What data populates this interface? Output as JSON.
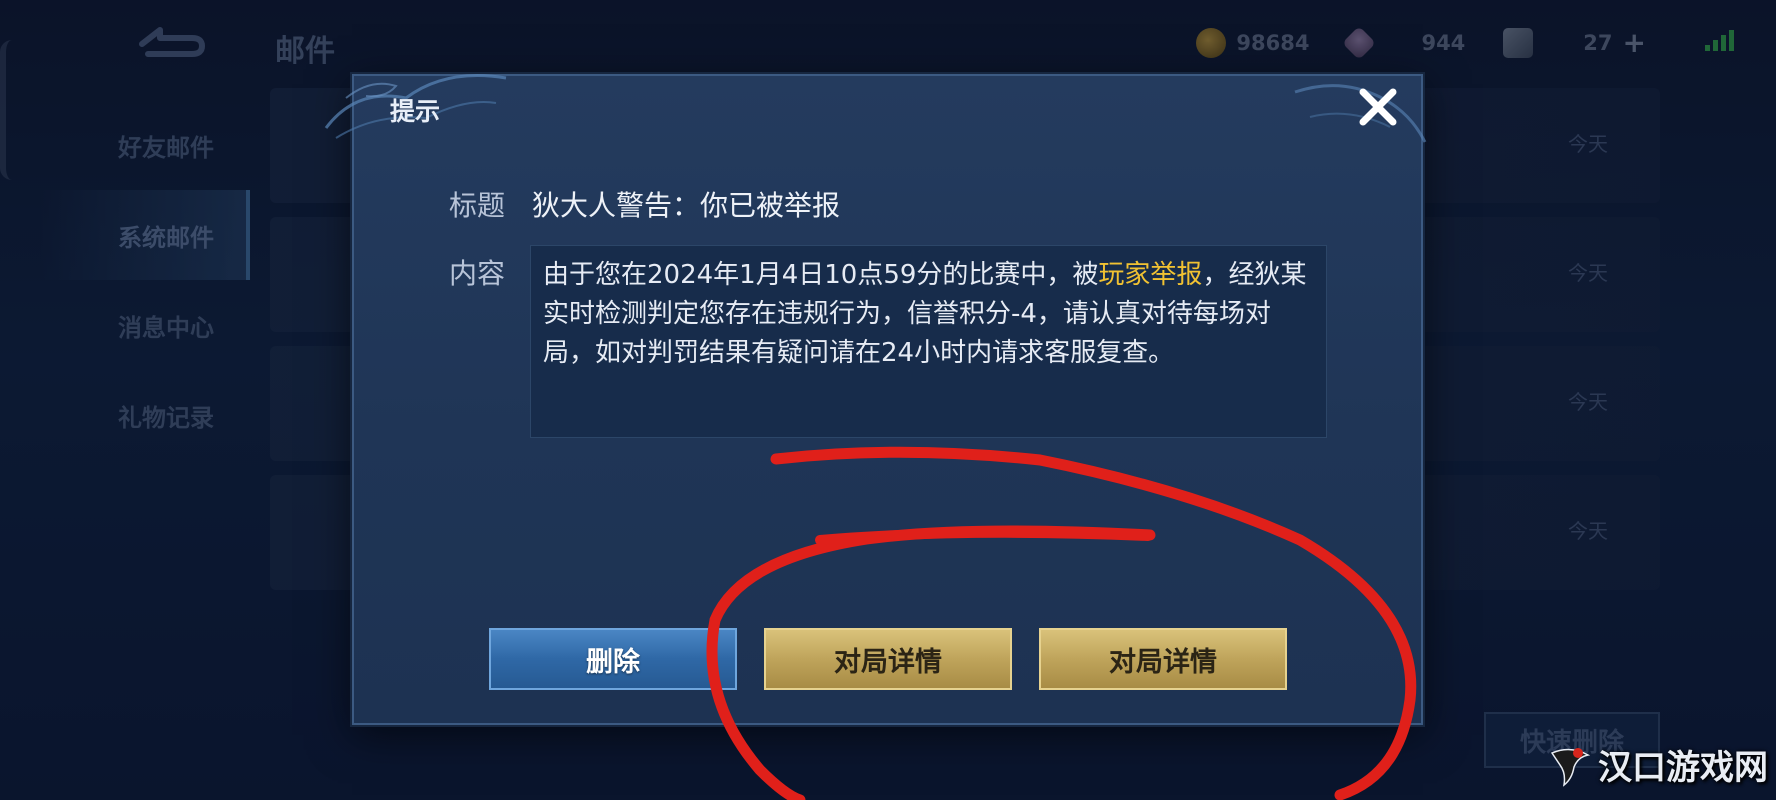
{
  "header": {
    "page_title": "邮件",
    "coins": "98684",
    "gems": "944",
    "tickets": "27",
    "plus_symbol": "+"
  },
  "sidebar": {
    "items": [
      {
        "label": "好友邮件"
      },
      {
        "label": "系统邮件"
      },
      {
        "label": "消息中心"
      },
      {
        "label": "礼物记录"
      }
    ],
    "active_index": 1
  },
  "mail_list": {
    "dates": [
      "今天",
      "今天",
      "今天",
      "今天"
    ],
    "quick_delete_label": "快速删除"
  },
  "dialog": {
    "title": "提示",
    "subject_label": "标题",
    "subject": "狄大人警告：你已被举报",
    "content_label": "内容",
    "content_before": "由于您在2024年1月4日10点59分的比赛中，被",
    "content_highlight": "玩家举报",
    "content_after": "，经狄某实时检测判定您存在违规行为，信誉积分-4，请认真对待每场对局，如对判罚结果有疑问请在24小时内请求客服复查。",
    "delete_label": "删除",
    "match_detail_label_1": "对局详情",
    "match_detail_label_2": "对局详情"
  },
  "watermark": {
    "text": "汉口游戏网"
  },
  "colors": {
    "highlight": "#f1c232",
    "annotation": "#e0201a",
    "delete_button": "#2f68a6",
    "gold_button": "#bfa45b"
  }
}
